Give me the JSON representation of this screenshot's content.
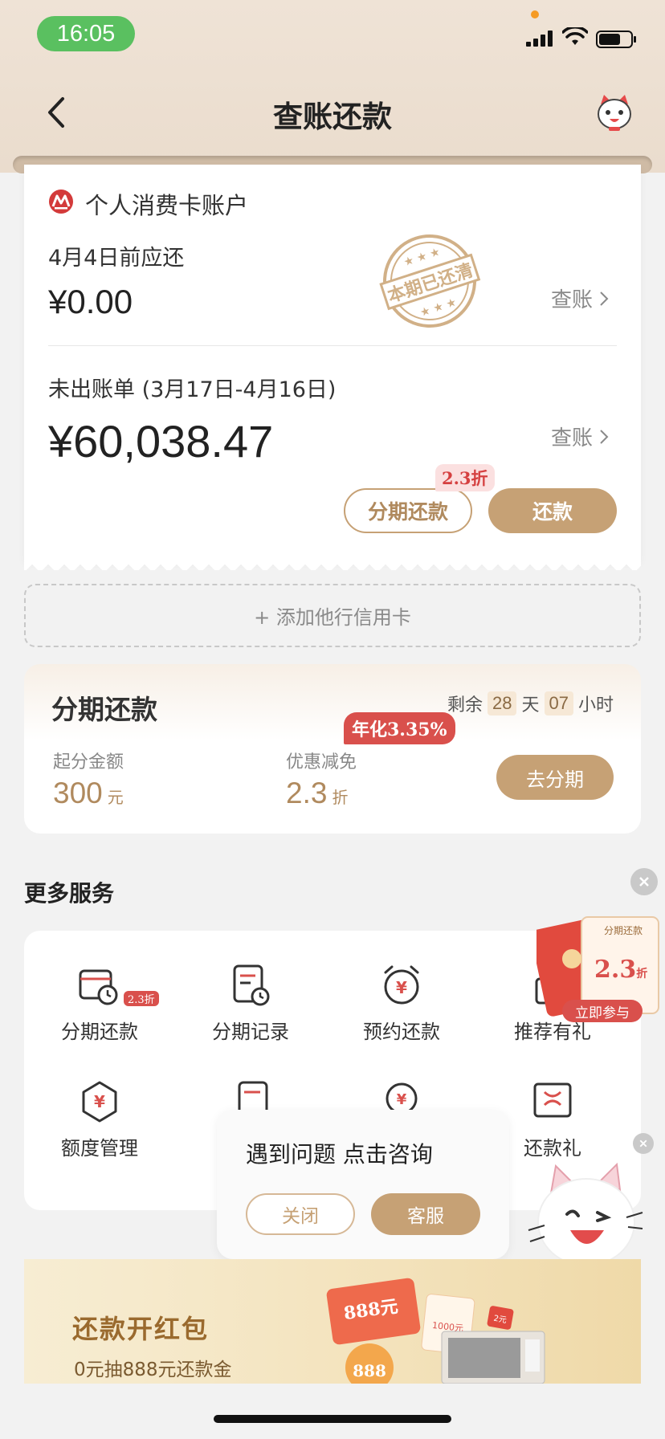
{
  "status_bar": {
    "time": "16:05"
  },
  "nav": {
    "title": "查账还款"
  },
  "bill": {
    "account_name": "个人消费卡账户",
    "due_label": "4月4日前应还",
    "due_amount": "¥0.00",
    "stamp_text": "本期已还清",
    "view_label": "查账",
    "unbilled_label": "未出账单 (3月17日-4月16日)",
    "unbilled_amount": "¥60,038.47",
    "installment_button": "分期还款",
    "discount_tag": "2.3折",
    "repay_button": "还款"
  },
  "add_card": {
    "label": "+ 添加他行信用卡"
  },
  "installment": {
    "title": "分期还款",
    "countdown_prefix": "剩余",
    "days": "28",
    "days_unit": "天",
    "hours": "07",
    "hours_unit": "小时",
    "min_amount_label": "起分金额",
    "min_amount_value": "300",
    "min_amount_unit": "元",
    "discount_label": "优惠减免",
    "discount_value": "2.3",
    "discount_unit": "折",
    "rate_tag": "年化3.35%",
    "go_button": "去分期"
  },
  "more_services": {
    "title": "更多服务",
    "items": [
      {
        "label": "分期还款",
        "icon": "calendar-clock-icon",
        "badge": "2.3折"
      },
      {
        "label": "分期记录",
        "icon": "document-clock-icon"
      },
      {
        "label": "预约还款",
        "icon": "alarm-clock-icon"
      },
      {
        "label": "推荐有礼",
        "icon": "gift-icon"
      },
      {
        "label": "额度管理",
        "icon": "shield-yen-icon"
      },
      {
        "label": "",
        "icon": "settings-card-icon"
      },
      {
        "label": "",
        "icon": "chat-yen-icon"
      },
      {
        "label": "还款礼",
        "icon": "ribbon-gift-icon"
      }
    ]
  },
  "float_promo": {
    "card_title": "分期还款",
    "card_value": "2.3",
    "card_unit": "折",
    "cta": "立即参与"
  },
  "consult_popup": {
    "text": "遇到问题 点击咨询",
    "close_button": "关闭",
    "service_button": "客服"
  },
  "banner": {
    "title": "还款开红包",
    "subtitle": "0元抽888元还款金",
    "art_amount": "888元",
    "art_amount_small": "888",
    "art_sub1": "1000元",
    "art_sub2": "2元"
  },
  "colors": {
    "accent": "#c6a175",
    "red": "#d9504c",
    "status_green": "#5ac060"
  }
}
